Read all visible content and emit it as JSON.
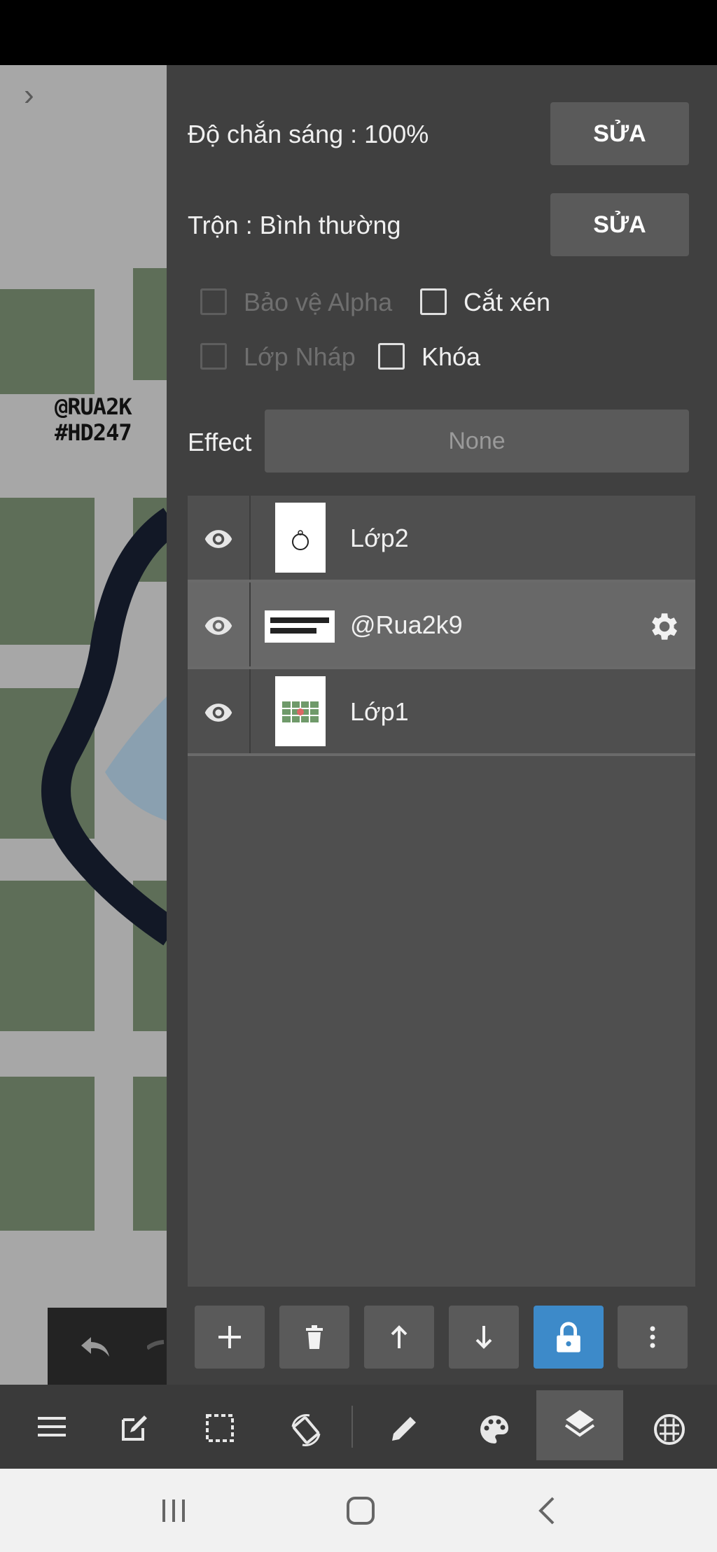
{
  "layer_properties": {
    "opacity_label": "Độ chắn sáng : 100%",
    "opacity_button": "SỬA",
    "blend_label": "Trộn : Bình thường",
    "blend_button": "SỬA",
    "protect_alpha": "Bảo vệ Alpha",
    "clipping": "Cắt xén",
    "draft_layer": "Lớp Nháp",
    "lock": "Khóa",
    "effect_label": "Effect",
    "effect_value": "None"
  },
  "layers": [
    {
      "name": "Lớp2"
    },
    {
      "name": "@Rua2k9"
    },
    {
      "name": "Lớp1"
    }
  ],
  "canvas": {
    "watermark_line1": "@RUA2K",
    "watermark_line2": "#HD247"
  },
  "colors": {
    "panel_bg": "#404040",
    "selected_row": "#686868",
    "lock_button_active": "#3d8ac9"
  }
}
